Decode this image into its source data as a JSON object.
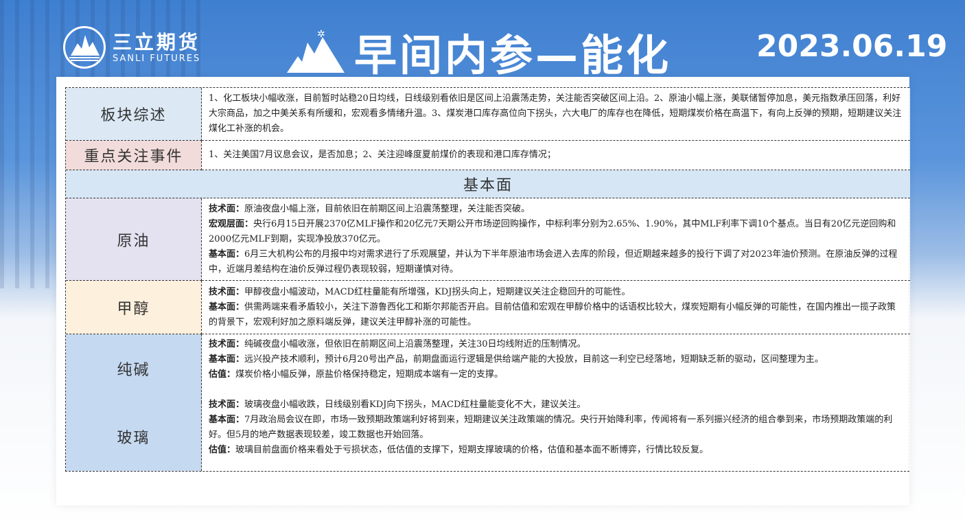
{
  "header": {
    "brand_cn": "三立期货",
    "brand_en": "SANLI FUTURES",
    "title": "早间内参—能化",
    "date": "2023.06.19"
  },
  "colors": {
    "header_blue": "#3f7fd0",
    "label_blue": "#dce9f5",
    "label_pink": "#f2dcdb",
    "label_lavender": "#e4e2f0",
    "label_cream": "#fdf0dc",
    "label_steel": "#c5d9f1"
  },
  "summary": {
    "label": "板块综述",
    "text": "1、化工板块小幅收涨，目前暂时站稳20日均线，日线级别看依旧是区间上沿震荡走势，关注能否突破区间上沿。2、原油小幅上涨，美联储暂停加息，美元指数承压回落，利好大宗商品，加之中美关系有所缓和，宏观看多情绪升温。3、煤炭港口库存高位向下拐头，六大电厂的库存也在降低，短期煤炭价格在高温下，有向上反弹的预期，短期建议关注煤化工补涨的机会。"
  },
  "events": {
    "label": "重点关注事件",
    "text": "1、关注美国7月议息会议，是否加息；2、关注迎峰度夏前煤价的表现和港口库存情况；"
  },
  "fundamentals_header": "基本面",
  "rows": [
    {
      "label": "原油",
      "items": [
        {
          "k": "技术面：",
          "v": "原油夜盘小幅上涨，目前依旧在前期区间上沿震荡整理，关注能否突破。"
        },
        {
          "k": "宏观层面：",
          "v": "央行6月15日开展2370亿MLF操作和20亿元7天期公开市场逆回购操作，中标利率分别为2.65%、1.90%，其中MLF利率下调10个基点。当日有20亿元逆回购和2000亿元MLF到期，实现净投放370亿元。"
        },
        {
          "k": "基本面：",
          "v": "6月三大机构公布的月报中均对需求进行了乐观展望，并认为下半年原油市场会进入去库的阶段，但近期越来越多的投行下调了对2023年油价预测。在原油反弹的过程中，近端月差结构在油价反弹过程仍表现较弱，短期谨慎对待。"
        }
      ]
    },
    {
      "label": "甲醇",
      "items": [
        {
          "k": "技术面：",
          "v": "甲醇夜盘小幅波动，MACD红柱量能有所增强，KDJ拐头向上，短期建议关注企稳回升的可能性。"
        },
        {
          "k": "基本面：",
          "v": "供需两端来看矛盾较小，关注下游鲁西化工和斯尔邦能否开启。目前估值和宏观在甲醇价格中的话语权比较大，煤炭短期有小幅反弹的可能性，在国内推出一揽子政策的背景下，宏观利好加之原料端反弹，建议关注甲醇补涨的可能性。"
        }
      ]
    },
    {
      "label": "纯碱",
      "items": [
        {
          "k": "技术面：",
          "v": "纯碱夜盘小幅收涨，但依旧在前期区间上沿震荡整理，关注30日均线附近的压制情况。"
        },
        {
          "k": "基本面：",
          "v": "远兴投产技术顺利，预计6月20号出产品，前期盘面运行逻辑是供给端产能的大投放，目前这一利空已经落地，短期缺乏新的驱动，区间整理为主。"
        },
        {
          "k": "估值：",
          "v": "煤炭价格小幅反弹，原盐价格保持稳定，短期成本端有一定的支撑。"
        }
      ]
    },
    {
      "label": "玻璃",
      "items": [
        {
          "k": "技术面：",
          "v": "玻璃夜盘小幅收跌，日线级别看KDJ向下拐头，MACD红柱量能变化不大，建议关注。"
        },
        {
          "k": "基本面：",
          "v": "7月政治局会议在即，市场一致预期政策端利好将到来，短期建议关注政策端的情况。央行开始降利率，传闻将有一系列振兴经济的组合拳到来，市场预期政策端的利好。但5月的地产数据表现较差，竣工数据也开始回落。"
        },
        {
          "k": "估值：",
          "v": "玻璃目前盘面价格来看处于亏损状态，低估值的支撑下，短期支撑玻璃的价格，估值和基本面不断博弈，行情比较反复。"
        }
      ]
    }
  ]
}
